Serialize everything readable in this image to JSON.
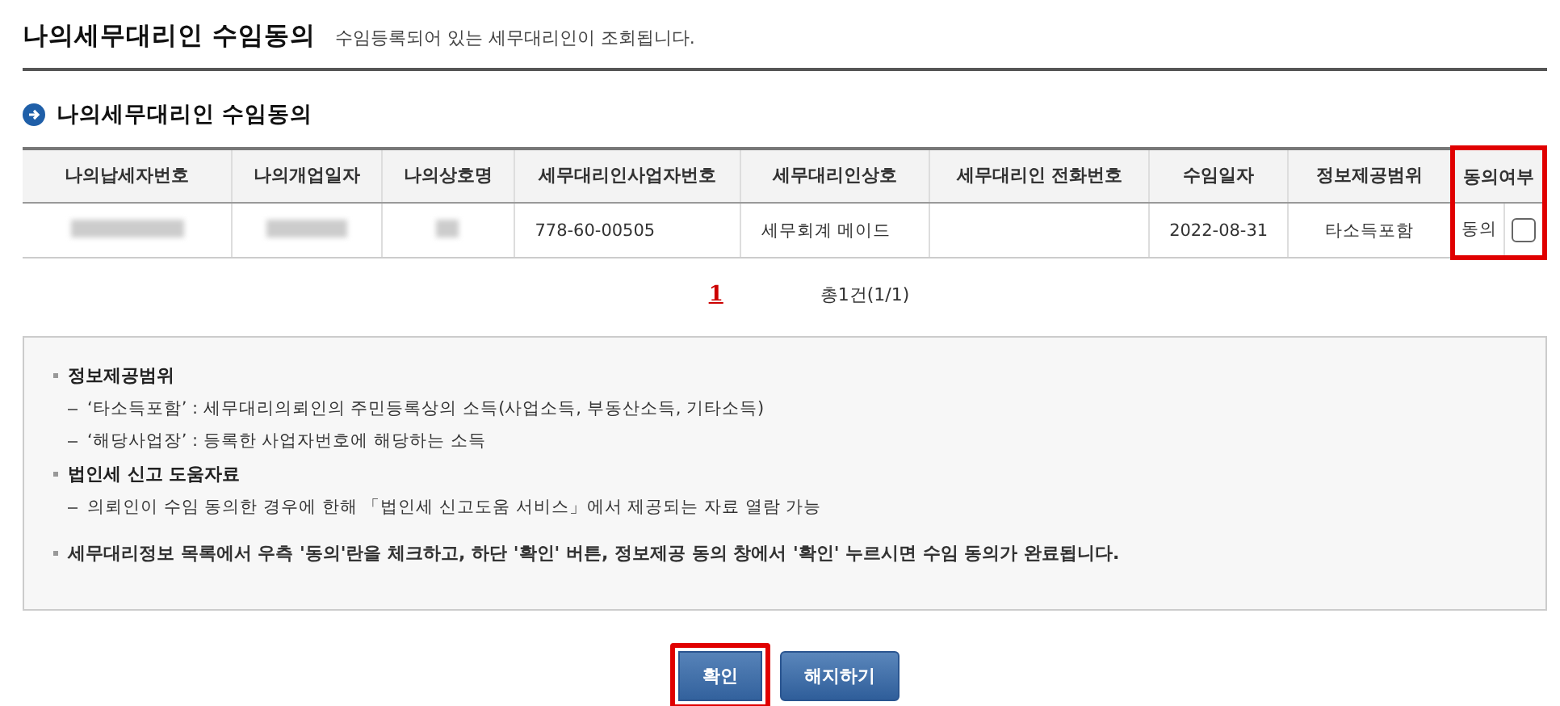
{
  "page": {
    "title": "나의세무대리인 수임동의",
    "subtitle": "수임등록되어 있는 세무대리인이 조회됩니다."
  },
  "section": {
    "title": "나의세무대리인 수임동의"
  },
  "table": {
    "columns": [
      {
        "label": "나의납세자번호",
        "highlighted": false
      },
      {
        "label": "나의개업일자",
        "highlighted": false
      },
      {
        "label": "나의상호명",
        "highlighted": false
      },
      {
        "label": "세무대리인사업자번호",
        "highlighted": false
      },
      {
        "label": "세무대리인상호",
        "highlighted": false
      },
      {
        "label": "세무대리인 전화번호",
        "highlighted": false
      },
      {
        "label": "수임일자",
        "highlighted": false
      },
      {
        "label": "정보제공범위",
        "highlighted": false
      },
      {
        "label": "동의여부",
        "highlighted": true
      }
    ],
    "rows": [
      {
        "cells": [
          {
            "kind": "redacted"
          },
          {
            "kind": "redacted"
          },
          {
            "kind": "redacted"
          },
          {
            "kind": "text",
            "text": "778-60-00505"
          },
          {
            "kind": "text",
            "text": "세무회계 메이드"
          },
          {
            "kind": "empty"
          },
          {
            "kind": "text",
            "text": "2022-08-31"
          },
          {
            "kind": "text",
            "text": "타소득포함"
          }
        ],
        "consent_label": "동의",
        "checked": false
      }
    ]
  },
  "pagination": {
    "pages": [
      {
        "label": "1",
        "selected": true
      }
    ],
    "summary": "총1건(1/1)"
  },
  "info": [
    {
      "kind": "bullet",
      "text": "정보제공범위"
    },
    {
      "kind": "dash",
      "text": "‘타소득포함’ : 세무대리의뢰인의 주민등록상의 소득(사업소득, 부동산소득, 기타소득)"
    },
    {
      "kind": "dash",
      "text": "‘해당사업장’ : 등록한 사업자번호에 해당하는 소득"
    },
    {
      "kind": "bullet",
      "text": "법인세 신고 도움자료"
    },
    {
      "kind": "dash",
      "text": "의뢰인이 수임 동의한 경우에 한해 「법인세 신고도움 서비스」에서 제공되는 자료 열람 가능"
    },
    {
      "kind": "note",
      "text": "세무대리정보 목록에서 우측 '동의'란을 체크하고, 하단 '확인' 버튼, 정보제공 동의 창에서 '확인' 누르시면 수임 동의가 완료됩니다."
    }
  ],
  "buttons": [
    {
      "label": "확인",
      "highlighted": true
    },
    {
      "label": "해지하기",
      "highlighted": false
    }
  ]
}
